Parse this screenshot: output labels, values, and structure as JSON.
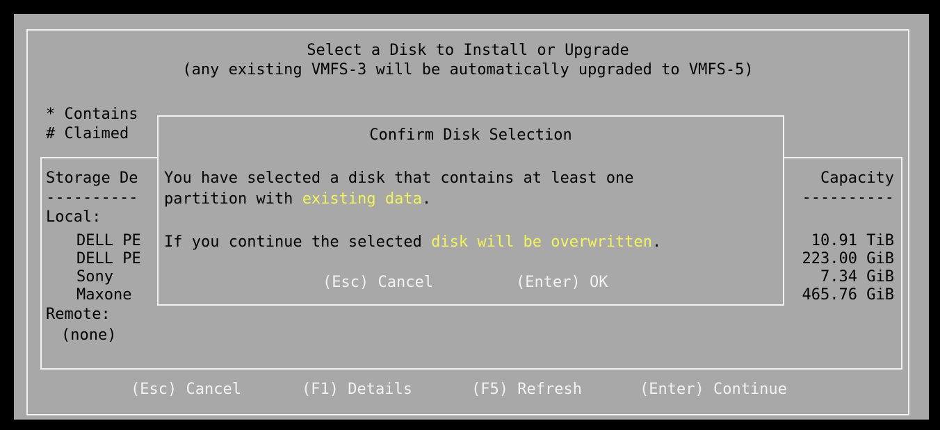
{
  "title": "Select a Disk to Install or Upgrade",
  "subtitle": "(any existing VMFS-3 will be automatically upgraded to VMFS-5)",
  "legend": {
    "contains": "* Contains",
    "claimed": "# Claimed"
  },
  "table": {
    "col_storage": "Storage De",
    "col_capacity": "Capacity",
    "separator_left": "----------",
    "separator_right": "----------",
    "local_label": "Local:",
    "remote_label": "Remote:",
    "remote_none": "(none)",
    "local_disks": [
      {
        "name": "DELL PE",
        "capacity": "10.91 TiB"
      },
      {
        "name": "DELL PE",
        "capacity": "223.00 GiB"
      },
      {
        "name": "Sony",
        "capacity": "7.34 GiB"
      },
      {
        "name": "Maxone",
        "capacity": "465.76 GiB"
      }
    ]
  },
  "dialog": {
    "title": "Confirm Disk Selection",
    "line1": "You have selected a disk that contains at least one",
    "line2_prefix": "partition with ",
    "line2_highlight": "existing data",
    "line2_suffix": ".",
    "line3_prefix": "If you continue the selected ",
    "line3_highlight": "disk will be overwritten",
    "line3_suffix": ".",
    "cancel": "(Esc) Cancel",
    "ok": "(Enter) OK"
  },
  "footer": {
    "cancel": "(Esc) Cancel",
    "details": "(F1) Details",
    "refresh": "(F5) Refresh",
    "continue": "(Enter) Continue"
  },
  "colors": {
    "background": "#a8a8a8",
    "border": "#f2f2f2",
    "highlight": "#f3f35a",
    "text": "#000000"
  }
}
